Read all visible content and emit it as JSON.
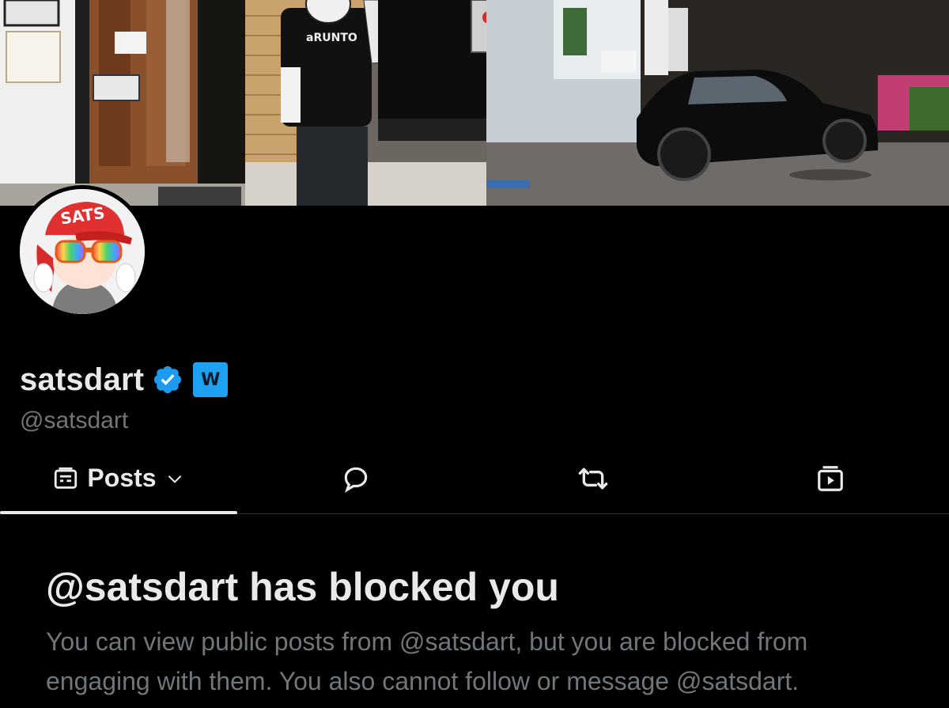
{
  "profile": {
    "display_name": "satsdart",
    "handle": "@satsdart",
    "avatar_cap_text": "SATS",
    "affiliate_badge_text": "W",
    "verified": true
  },
  "tabs": [
    {
      "label": "Posts",
      "icon": "posts-icon",
      "has_dropdown": true,
      "active": true
    },
    {
      "label": "",
      "icon": "reply-icon",
      "active": false
    },
    {
      "label": "",
      "icon": "repost-icon",
      "active": false
    },
    {
      "label": "",
      "icon": "media-icon",
      "active": false
    }
  ],
  "blocked": {
    "title": "@satsdart has blocked you",
    "message": "You can view public posts from @satsdart, but you are blocked from engaging with them. You also cannot follow or message @satsdart."
  },
  "banner": {
    "shirt_text": "aRUNTO"
  },
  "colors": {
    "background": "#000000",
    "primary_text": "#e7e9ea",
    "secondary_text": "#71767b",
    "verified_blue": "#1d9bf0",
    "divider": "#2f3336"
  }
}
